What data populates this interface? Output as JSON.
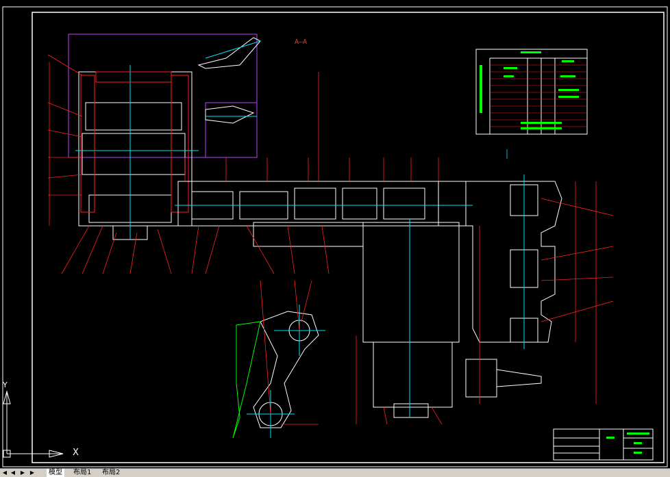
{
  "drawing": {
    "section_label": "A—A",
    "axis_x": "X",
    "axis_y": "Y"
  },
  "tabs": {
    "model": "模型",
    "layout1": "布局1",
    "layout2": "布局2"
  },
  "nav": {
    "first": "◀",
    "prev": "◀",
    "next": "▶",
    "last": "▶"
  },
  "colors": {
    "background": "#000000",
    "outline": "#ffffff",
    "dimension": "#ff2020",
    "centerline": "#00e5ff",
    "text": "#00ff00",
    "frame": "#c040ff"
  }
}
